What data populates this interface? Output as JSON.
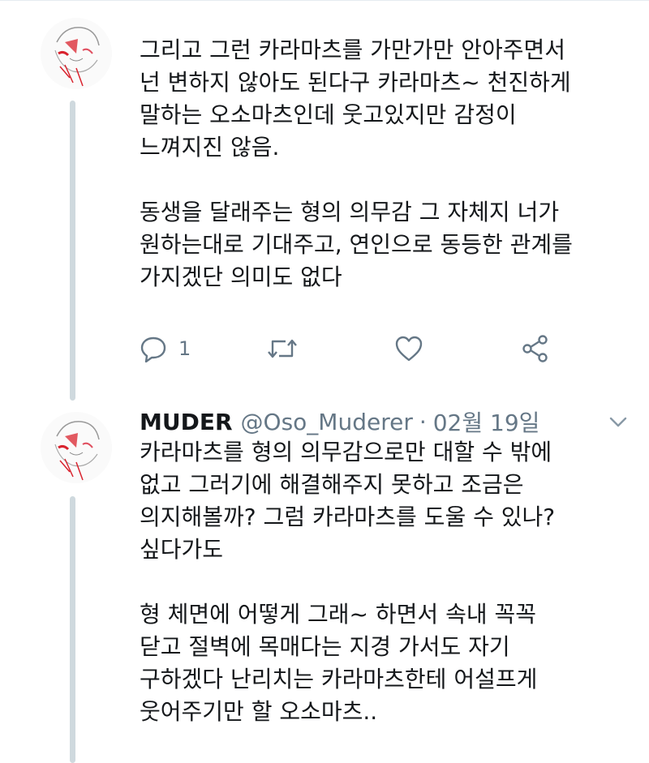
{
  "tweet1": {
    "lines": [
      "그리고 그런 카라마츠를 가만가만 안아주면서",
      "넌 변하지 않아도 된다구 카라마츠~ 천진하게",
      "말하는 오소마츠인데 웃고있지만 감정이",
      "느껴지진 않음.",
      "동생을 달래주는 형의 의무감 그 자체지 너가",
      "원하는대로 기대주고, 연인으로 동등한 관계를",
      "가지겠단 의미도 없다"
    ],
    "reply_count": "1"
  },
  "tweet2": {
    "display_name": "MUDER",
    "handle": "@Oso_Muderer",
    "separator": "·",
    "date": "02월 19일",
    "lines": [
      "카라마츠를 형의 의무감으로만 대할 수 밖에",
      "없고 그러기에 해결해주지 못하고 조금은",
      "의지해볼까? 그럼 카라마츠를 도울 수 있나?",
      "싶다가도",
      "형 체면에 어떻게 그래~ 하면서 속내 꼭꼭",
      "닫고 절벽에 목매다는 지경 가서도 자기",
      "구하겠다 난리치는 카라마츠한테 어설프게",
      "웃어주기만 할 오소마츠.."
    ]
  },
  "icons": {
    "reply": "reply-icon",
    "retweet": "retweet-icon",
    "like": "heart-icon",
    "share": "share-icon",
    "caret": "chevron-down-icon"
  },
  "colors": {
    "text": "#14171a",
    "muted": "#657786",
    "thread_line": "#cfd9de",
    "avatar_accent": "#d9232e"
  }
}
